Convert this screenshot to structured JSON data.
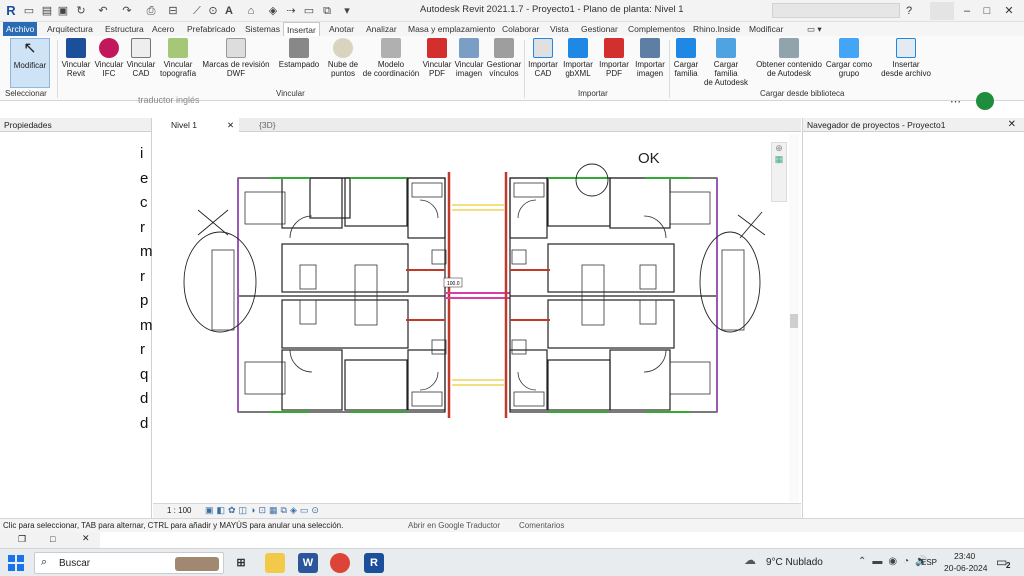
{
  "window": {
    "title": "Autodesk Revit 2021.1.7 - Proyecto1 - Plano de planta: Nivel 1",
    "app_logo": "R"
  },
  "menu_tabs": [
    "Archivo",
    "Arquitectura",
    "Estructura",
    "Acero",
    "Prefabricado",
    "Sistemas",
    "Insertar",
    "Anotar",
    "Analizar",
    "Masa y emplazamiento",
    "Colaborar",
    "Vista",
    "Gestionar",
    "Complementos",
    "Rhino.Inside",
    "Modificar"
  ],
  "active_tab": "Insertar",
  "ribbon": {
    "buttons": [
      {
        "label1": "Modificar",
        "label2": "",
        "icon": "cursor-icon"
      },
      {
        "label1": "Vincular",
        "label2": "Revit",
        "icon": "link-revit-icon"
      },
      {
        "label1": "Vincular",
        "label2": "IFC",
        "icon": "link-ifc-icon"
      },
      {
        "label1": "Vincular",
        "label2": "CAD",
        "icon": "link-cad-icon"
      },
      {
        "label1": "Vincular",
        "label2": "topografía",
        "icon": "link-topography-icon"
      },
      {
        "label1": "Marcas de revisión",
        "label2": "DWF",
        "icon": "dwf-markup-icon"
      },
      {
        "label1": "Estampado",
        "label2": "",
        "icon": "decal-icon"
      },
      {
        "label1": "Nube de",
        "label2": "puntos",
        "icon": "point-cloud-icon"
      },
      {
        "label1": "Modelo",
        "label2": "de coordinación",
        "icon": "coordination-model-icon"
      },
      {
        "label1": "Vincular",
        "label2": "PDF",
        "icon": "link-pdf-icon"
      },
      {
        "label1": "Vincular",
        "label2": "imagen",
        "icon": "link-image-icon"
      },
      {
        "label1": "Gestionar",
        "label2": "vínculos",
        "icon": "manage-links-icon"
      },
      {
        "label1": "Importar",
        "label2": "CAD",
        "icon": "import-cad-icon"
      },
      {
        "label1": "Importar",
        "label2": "gbXML",
        "icon": "import-gbxml-icon"
      },
      {
        "label1": "Importar",
        "label2": "PDF",
        "icon": "import-pdf-icon"
      },
      {
        "label1": "Importar",
        "label2": "imagen",
        "icon": "import-image-icon"
      },
      {
        "label1": "Cargar",
        "label2": "familia",
        "icon": "load-family-icon"
      },
      {
        "label1": "Cargar familia",
        "label2": "de Autodesk",
        "icon": "load-autodesk-family-icon"
      },
      {
        "label1": "Obtener contenido",
        "label2": "de Autodesk",
        "icon": "get-content-icon"
      },
      {
        "label1": "Cargar como",
        "label2": "grupo",
        "icon": "load-group-icon"
      },
      {
        "label1": "Insertar",
        "label2": "desde archivo",
        "icon": "insert-from-file-icon"
      }
    ],
    "groups": [
      "Seleccionar",
      "Vincular",
      "Importar",
      "Cargar desde biblioteca"
    ]
  },
  "behind_window_text": "traductor inglés",
  "properties_panel": {
    "title": "Propiedades"
  },
  "background_letters": [
    "i",
    "e",
    "c",
    "r",
    "m",
    "r",
    "p",
    "m",
    "r",
    "q",
    "d",
    "d"
  ],
  "view_tabs": [
    {
      "label": "Nivel 1"
    },
    {
      "label": "{3D}"
    }
  ],
  "project_browser": {
    "title": "Navegador de proyectos - Proyecto1"
  },
  "view_control": {
    "scale": "1 : 100"
  },
  "drawing": {
    "dimension_label": "100.0",
    "annotation": "OK"
  },
  "status_bar": {
    "hint": "Clic para seleccionar, TAB para alternar, CTRL para añadir y MAYÚS para anular una selección.",
    "translate_link": "Abrir en Google Traductor",
    "comments_link": "Comentarios"
  },
  "taskbar": {
    "search_placeholder": "Buscar",
    "weather": "9°C  Nublado",
    "language": "ESP",
    "time": "23:40",
    "date": "20-06-2024",
    "notifications": "2"
  },
  "colors": {
    "file_tab": "#2a6bb5",
    "wall": "#222222",
    "purple": "#9b59b6",
    "green": "#33aa33",
    "red": "#c0392b",
    "magenta": "#d63fa5"
  }
}
